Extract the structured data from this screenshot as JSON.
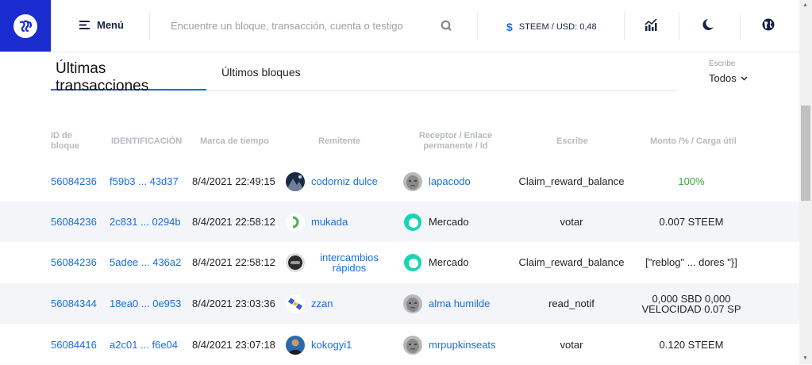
{
  "header": {
    "menu_label": "Menú",
    "search_placeholder": "Encuentre un bloque, transacción, cuenta o testigo",
    "price_label": "STEEM / USD: 0,48",
    "price_symbol": "$"
  },
  "tabs": {
    "active": "Últimas transacciones",
    "inactive": "Últimos bloques"
  },
  "filter": {
    "label": "Escribe",
    "value": "Todos"
  },
  "table": {
    "headers": {
      "block_id": "ID de bloque",
      "identification": "IDENTIFICACIÓN",
      "timestamp": "Marca de tiempo",
      "sender": "Remitente",
      "receiver": "Receptor / Enlace permanente / Id",
      "type": "Escribe",
      "amount": "Monto /% / Carga útil"
    },
    "rows": [
      {
        "block": "56084236",
        "tx": "f59b3 ... 43d37",
        "time": "8/4/2021 22:49:15",
        "sender": "codorniz dulce",
        "sender_avatar": "mountain-avatar",
        "receiver": "lapacodo",
        "receiver_avatar": "stone-face-avatar",
        "type": "Claim_reward_balance",
        "amount": "100%",
        "amount_color": "#3aa63a"
      },
      {
        "block": "56084236",
        "tx": "2c831 ... 0294b",
        "time": "8/4/2021 22:58:12",
        "sender": "mukada",
        "sender_avatar": "green-c-avatar",
        "receiver": "Mercado",
        "receiver_avatar": "market-logo-avatar",
        "type": "votar",
        "amount": "0.007 STEEM",
        "amount_color": "#222222"
      },
      {
        "block": "56084236",
        "tx": "5adee ... 436a2",
        "time": "8/4/2021 22:58:12",
        "sender": "intercambios rápidos",
        "sender_avatar": "helmet-avatar",
        "receiver": "Mercado",
        "receiver_avatar": "market-logo-avatar",
        "type": "Claim_reward_balance",
        "amount": "[\"reblog\" ... dores \"}]",
        "amount_color": "#222222"
      },
      {
        "block": "56084344",
        "tx": "18ea0 ... 0e953",
        "time": "8/4/2021 23:03:36",
        "sender": "zzan",
        "sender_avatar": "satellite-avatar",
        "receiver": "alma humilde",
        "receiver_avatar": "stone-face-avatar",
        "type": "read_notif",
        "amount": "0,000 SBD 0,000 VELOCIDAD 0.07 SP",
        "amount_color": "#222222"
      },
      {
        "block": "56084416",
        "tx": "a2c01 ... f6e04",
        "time": "8/4/2021 23:07:18",
        "sender": "kokogyi1",
        "sender_avatar": "person-avatar",
        "receiver": "mrpupkinseats",
        "receiver_avatar": "stone-face-avatar",
        "type": "votar",
        "amount": "0.120 STEEM",
        "amount_color": "#222222"
      }
    ]
  },
  "colors": {
    "brand": "#1a2bd0",
    "link": "#1c6ee0",
    "success": "#3aa63a"
  }
}
